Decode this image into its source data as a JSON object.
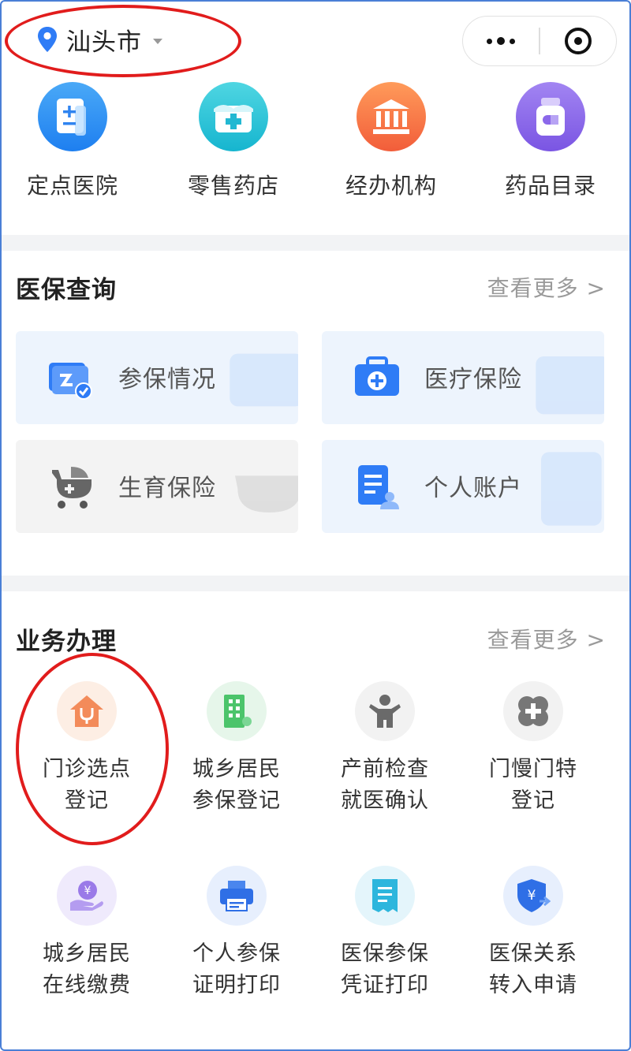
{
  "header": {
    "city": "汕头市",
    "capsule": {
      "more_icon": "more-dots-icon",
      "close_icon": "record-target-icon"
    }
  },
  "quick_links": [
    {
      "label": "定点医院",
      "icon": "hospital-document-icon",
      "color_top": "#4aa9f7",
      "color_bottom": "#1e7ff0"
    },
    {
      "label": "零售药店",
      "icon": "pharmacy-shop-icon",
      "color_top": "#4fd6e2",
      "color_bottom": "#16b5cf"
    },
    {
      "label": "经办机构",
      "icon": "institution-building-icon",
      "color_top": "#ff9b5a",
      "color_bottom": "#f25d3a"
    },
    {
      "label": "药品目录",
      "icon": "medicine-bottle-icon",
      "color_top": "#a285f2",
      "color_bottom": "#7a55e3"
    }
  ],
  "insurance_query": {
    "title": "医保查询",
    "more": "查看更多 >",
    "cards": [
      {
        "label": "参保情况",
        "icon": "insured-card-check-icon",
        "style": "blue"
      },
      {
        "label": "医疗保险",
        "icon": "medical-kit-icon",
        "style": "blue"
      },
      {
        "label": "生育保险",
        "icon": "baby-stroller-icon",
        "style": "gray"
      },
      {
        "label": "个人账户",
        "icon": "personal-account-document-icon",
        "style": "blue"
      }
    ]
  },
  "business": {
    "title": "业务办理",
    "more": "查看更多 >",
    "items": [
      {
        "line1": "门诊选点",
        "line2": "登记",
        "icon": "clinic-house-stethoscope-icon",
        "bg": "#fdeee4"
      },
      {
        "line1": "城乡居民",
        "line2": "参保登记",
        "icon": "building-icon",
        "bg": "#e6f6ea"
      },
      {
        "line1": "产前检查",
        "line2": "就医确认",
        "icon": "child-icon",
        "bg": "#f2f2f2"
      },
      {
        "line1": "门慢门特",
        "line2": "登记",
        "icon": "medical-cross-clover-icon",
        "bg": "#f2f2f2"
      },
      {
        "line1": "城乡居民",
        "line2": "在线缴费",
        "icon": "yuan-hand-icon",
        "bg": "#efeafc"
      },
      {
        "line1": "个人参保",
        "line2": "证明打印",
        "icon": "printer-icon",
        "bg": "#e7effd"
      },
      {
        "line1": "医保参保",
        "line2": "凭证打印",
        "icon": "receipt-icon",
        "bg": "#e4f5fb"
      },
      {
        "line1": "医保关系",
        "line2": "转入申请",
        "icon": "yuan-shield-transfer-icon",
        "bg": "#e7effd"
      }
    ]
  }
}
